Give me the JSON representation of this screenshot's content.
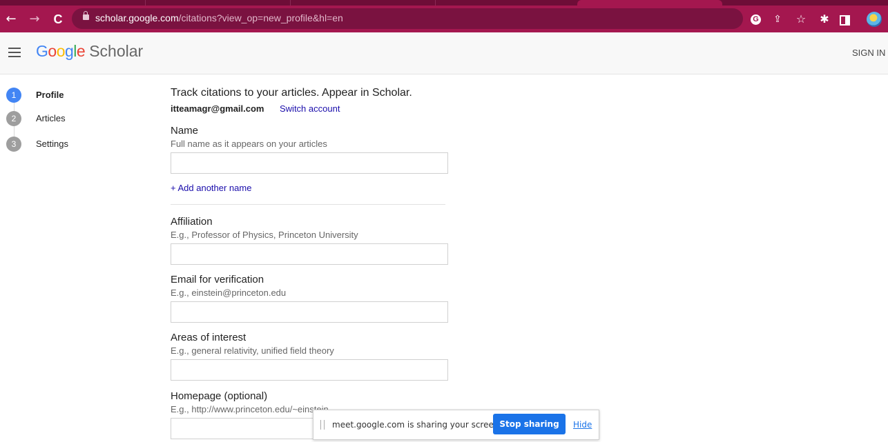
{
  "browser": {
    "url_host": "scholar.google.com",
    "url_path": "/citations?view_op=new_profile&hl=en",
    "back_glyph": "←",
    "forward_glyph": "→",
    "reload_glyph": "C",
    "google_badge": "G",
    "share_glyph": "⇪",
    "star_glyph": "☆",
    "extensions_glyph": "✱",
    "icons": [
      "back-arrow-icon",
      "forward-arrow-icon",
      "reload-icon",
      "lock-icon",
      "google-icon",
      "share-icon",
      "star-icon",
      "extensions-icon",
      "side-panel-icon",
      "profile-avatar"
    ],
    "colors": {
      "toolbar": "#a4174f",
      "tabstrip": "#6e0d37",
      "omnibox": "#7a1240"
    }
  },
  "header": {
    "logo_letters": [
      {
        "ch": "G",
        "color": "#4285f4"
      },
      {
        "ch": "o",
        "color": "#ea4335"
      },
      {
        "ch": "o",
        "color": "#fbbc05"
      },
      {
        "ch": "g",
        "color": "#4285f4"
      },
      {
        "ch": "l",
        "color": "#34a853"
      },
      {
        "ch": "e",
        "color": "#ea4335"
      }
    ],
    "logo_suffix": "Scholar",
    "sign_in": "SIGN IN"
  },
  "steps": [
    {
      "number": "1",
      "label": "Profile",
      "active": true
    },
    {
      "number": "2",
      "label": "Articles",
      "active": false
    },
    {
      "number": "3",
      "label": "Settings",
      "active": false
    }
  ],
  "form": {
    "heading": "Track citations to your articles. Appear in Scholar.",
    "account_email": "itteamagr@gmail.com",
    "switch_account": "Switch account",
    "add_another_name": "+ Add another name",
    "fields": [
      {
        "label": "Name",
        "hint": "Full name as it appears on your articles",
        "value": ""
      },
      {
        "label": "Affiliation",
        "hint": "E.g., Professor of Physics, Princeton University",
        "value": ""
      },
      {
        "label": "Email for verification",
        "hint": "E.g., einstein@princeton.edu",
        "value": ""
      },
      {
        "label": "Areas of interest",
        "hint": "E.g., general relativity, unified field theory",
        "value": ""
      },
      {
        "label": "Homepage (optional)",
        "hint": "E.g., http://www.princeton.edu/~einstein",
        "value": ""
      }
    ]
  },
  "share_bar": {
    "message": "meet.google.com is sharing your screen.",
    "stop_label": "Stop sharing",
    "hide_label": "Hide"
  },
  "colors": {
    "accent": "#4285f4",
    "link": "#1a0dab",
    "step_inactive": "#9e9e9e",
    "stop_button": "#1a73e8"
  }
}
